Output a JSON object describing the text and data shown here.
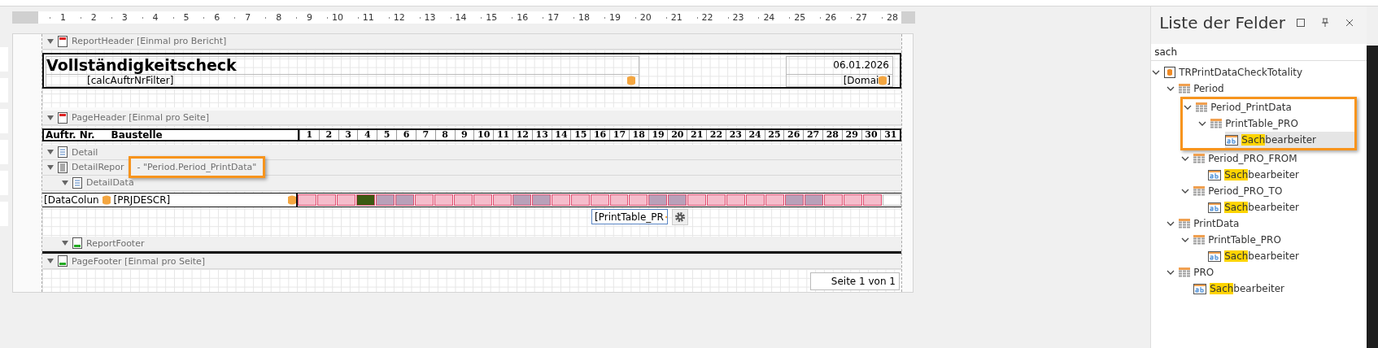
{
  "ruler": {
    "marks": [
      "1",
      "2",
      "3",
      "4",
      "5",
      "6",
      "7",
      "8",
      "9",
      "10",
      "11",
      "12",
      "13",
      "14",
      "15",
      "16",
      "17",
      "18",
      "19",
      "20",
      "21",
      "22",
      "23",
      "24",
      "25",
      "26",
      "27",
      "28"
    ]
  },
  "report_header": {
    "caption": "ReportHeader [Einmal pro Bericht]",
    "expanded": true,
    "title": "Vollständigkeitscheck",
    "filter": "[calcAuftrNrFilter]",
    "date": "06.01.2026",
    "domain": "[Domai",
    "domain_end": "]"
  },
  "page_header": {
    "caption": "PageHeader [Einmal pro Seite]",
    "expanded": true,
    "columns": [
      "Auftr. Nr.",
      "Baustelle"
    ],
    "days": [
      "1",
      "2",
      "3",
      "4",
      "5",
      "6",
      "7",
      "8",
      "9",
      "10",
      "11",
      "12",
      "13",
      "14",
      "15",
      "16",
      "17",
      "18",
      "19",
      "20",
      "21",
      "22",
      "23",
      "24",
      "25",
      "26",
      "27",
      "28",
      "29",
      "30",
      "31"
    ]
  },
  "detail": {
    "caption": "Detail",
    "expanded": true
  },
  "detail_report": {
    "caption": "DetailRepor",
    "expanded": true,
    "data_member": "- \"Period.Period_PrintData\"",
    "highlighted": true
  },
  "detail_data": {
    "caption": "DetailData",
    "expanded": true,
    "fields": [
      "[DataColun",
      "[PRJDESCR]"
    ],
    "day_cells": [
      {
        "color": "#f5bccb"
      },
      {
        "color": "#f5bccb"
      },
      {
        "color": "#f5bccb"
      },
      {
        "color": "#3b5a12"
      },
      {
        "color": "#b9a0b9"
      },
      {
        "color": "#b9a0b9"
      },
      {
        "color": "#f5bccb"
      },
      {
        "color": "#f5bccb"
      },
      {
        "color": "#f5bccb"
      },
      {
        "color": "#f5bccb"
      },
      {
        "color": "#f5bccb"
      },
      {
        "color": "#b9a0b9"
      },
      {
        "color": "#b9a0b9"
      },
      {
        "color": "#f5bccb"
      },
      {
        "color": "#f5bccb"
      },
      {
        "color": "#f5bccb"
      },
      {
        "color": "#f5bccb"
      },
      {
        "color": "#f5bccb"
      },
      {
        "color": "#b9a0b9"
      },
      {
        "color": "#b9a0b9"
      },
      {
        "color": "#f5bccb"
      },
      {
        "color": "#f5bccb"
      },
      {
        "color": "#f5bccb"
      },
      {
        "color": "#f5bccb"
      },
      {
        "color": "#f5bccb"
      },
      {
        "color": "#b9a0b9"
      },
      {
        "color": "#b9a0b9"
      },
      {
        "color": "#f5bccb"
      },
      {
        "color": "#f5bccb"
      },
      {
        "color": "#f5bccb"
      },
      {
        "color": "#ffffff"
      }
    ],
    "selected_control": "[PrintTable_PR"
  },
  "report_footer": {
    "caption": "ReportFooter",
    "expanded": true
  },
  "page_footer": {
    "caption": "PageFooter [Einmal pro Seite]",
    "expanded": true,
    "page_info": "Seite 1 von 1"
  },
  "field_list": {
    "title": "Liste der Felder",
    "search": "sach",
    "tree": [
      {
        "kind": "datasource",
        "label": "TRPrintDataCheckTotality",
        "expanded": true,
        "selected": false,
        "children": [
          {
            "kind": "table",
            "label": "Period",
            "expanded": true,
            "selected": false,
            "children": [
              {
                "kind": "table",
                "label": "Period_PrintData",
                "expanded": true,
                "selected": false,
                "highlighted": true,
                "children": [
                  {
                    "kind": "table",
                    "label": "PrintTable_PRO",
                    "expanded": true,
                    "selected": false,
                    "children": [
                      {
                        "kind": "field",
                        "match": "Sach",
                        "label": "bearbeiter",
                        "selected": true
                      }
                    ]
                  }
                ]
              },
              {
                "kind": "table",
                "label": "Period_PRO_FROM",
                "expanded": true,
                "selected": false,
                "children": [
                  {
                    "kind": "field",
                    "match": "Sach",
                    "label": "bearbeiter",
                    "selected": false
                  }
                ]
              },
              {
                "kind": "table",
                "label": "Period_PRO_TO",
                "expanded": true,
                "selected": false,
                "children": [
                  {
                    "kind": "field",
                    "match": "Sach",
                    "label": "bearbeiter",
                    "selected": false
                  }
                ]
              }
            ]
          },
          {
            "kind": "table",
            "label": "PrintData",
            "expanded": true,
            "selected": false,
            "children": [
              {
                "kind": "table",
                "label": "PrintTable_PRO",
                "expanded": true,
                "selected": false,
                "children": [
                  {
                    "kind": "field",
                    "match": "Sach",
                    "label": "bearbeiter",
                    "selected": false
                  }
                ]
              }
            ]
          },
          {
            "kind": "table",
            "label": "PRO",
            "expanded": true,
            "selected": false,
            "children": [
              {
                "kind": "field",
                "match": "Sach",
                "label": "bearbeiter",
                "selected": false
              }
            ]
          }
        ]
      }
    ]
  }
}
